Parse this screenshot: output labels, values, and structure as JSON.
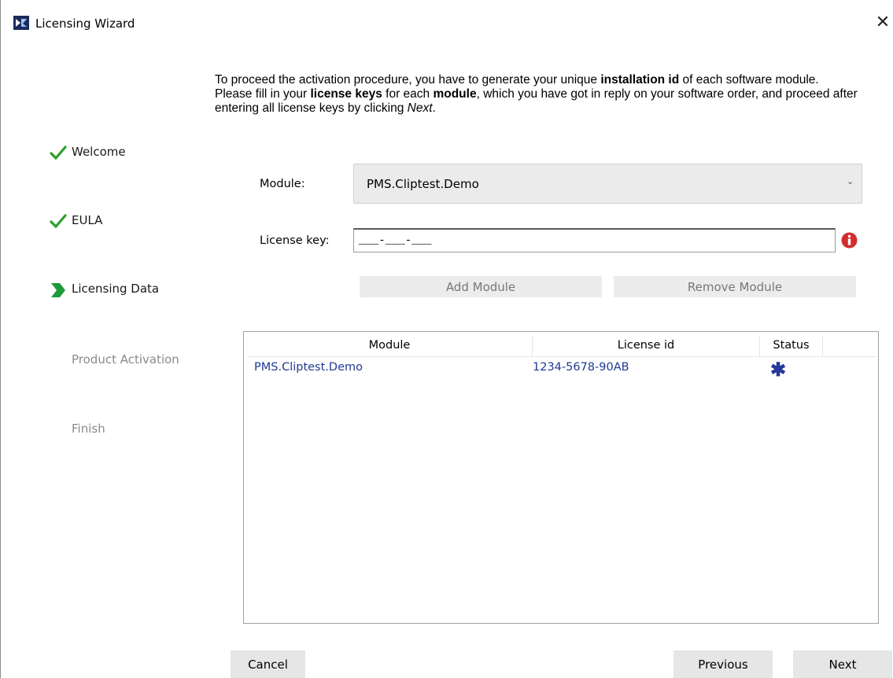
{
  "window": {
    "title": "Licensing Wizard",
    "close_glyph": "✕"
  },
  "steps": [
    {
      "label": "Welcome",
      "state": "done",
      "icon": "checkmark-icon"
    },
    {
      "label": "EULA",
      "state": "done",
      "icon": "checkmark-icon"
    },
    {
      "label": "Licensing Data",
      "state": "current",
      "icon": "chevron-right-icon"
    },
    {
      "label": "Product Activation",
      "state": "pending"
    },
    {
      "label": "Finish",
      "state": "pending"
    }
  ],
  "intro": {
    "p1_a": "To proceed the activation procedure, you have to generate your unique ",
    "p1_b": "installation id",
    "p1_c": " of each software module.",
    "p2_a": "Please fill in your ",
    "p2_b": "license keys",
    "p2_c": " for each ",
    "p2_d": "module",
    "p2_e": ", which you have got in reply on your software order, and proceed after entering all license keys by clicking ",
    "p2_f": "Next",
    "p2_g": "."
  },
  "form": {
    "module_label": "Module:",
    "module_value": "PMS.Cliptest.Demo",
    "license_label": "License key:",
    "license_value": "___-___-___"
  },
  "buttons": {
    "add_module": "Add Module",
    "remove_module": "Remove Module",
    "cancel": "Cancel",
    "previous": "Previous",
    "next": "Next"
  },
  "table": {
    "columns": [
      "Module",
      "License id",
      "Status"
    ],
    "rows": [
      {
        "module": "PMS.Cliptest.Demo",
        "license_id": "1234-5678-90AB",
        "status": "✱"
      }
    ]
  },
  "colors": {
    "check_green": "#2e9e2e",
    "chevron_green": "#1f9a3a",
    "error_red": "#d12f2f",
    "table_text": "#1f3a93"
  }
}
